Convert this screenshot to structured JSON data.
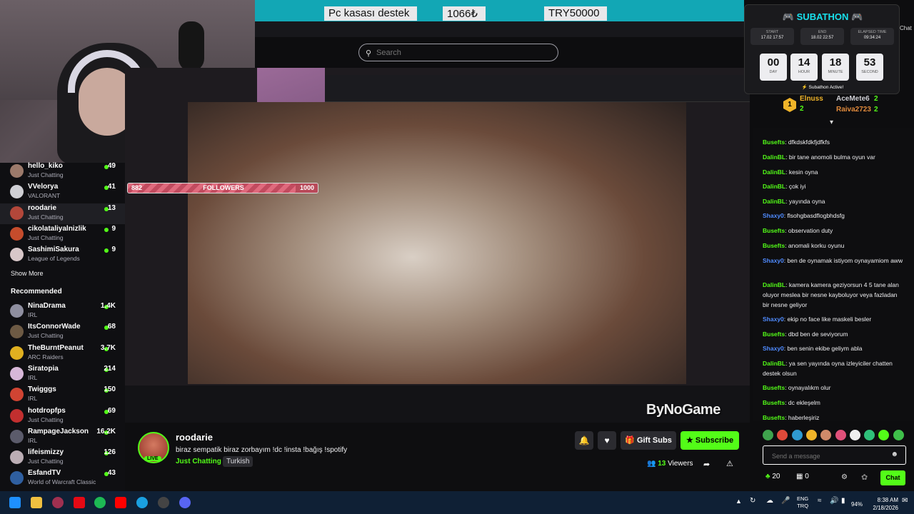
{
  "banner": {
    "ticker1": "Pc kasası destek",
    "ticker2": "1066₺",
    "ticker3": "TRY50000"
  },
  "search": {
    "placeholder": "Search"
  },
  "sidebar": {
    "following": [
      {
        "name": "hello_kiko",
        "category": "Just Chatting",
        "viewers": "49",
        "color": "#9c7a6b"
      },
      {
        "name": "VVelorya",
        "category": "VALORANT",
        "viewers": "41",
        "color": "#cfcfd4"
      },
      {
        "name": "roodarie",
        "category": "Just Chatting",
        "viewers": "13",
        "color": "#b3473a"
      },
      {
        "name": "cikolataliyalnizlik",
        "category": "Just Chatting",
        "viewers": "9",
        "color": "#c54c2c"
      },
      {
        "name": "SashimiSakura",
        "category": "League of Legends",
        "viewers": "9",
        "color": "#d8c7c9"
      }
    ],
    "show_more": "Show More",
    "recommended_title": "Recommended",
    "recommended": [
      {
        "name": "NinaDrama",
        "category": "IRL",
        "viewers": "1.4K",
        "color": "#8f8fa0"
      },
      {
        "name": "ItsConnorWade",
        "category": "Just Chatting",
        "viewers": "68",
        "color": "#6d5a44"
      },
      {
        "name": "TheBurntPeanut",
        "category": "ARC Raiders",
        "viewers": "3.7K",
        "color": "#e0b020"
      },
      {
        "name": "Siratopia",
        "category": "IRL",
        "viewers": "214",
        "color": "#d7b7d8"
      },
      {
        "name": "Twigggs",
        "category": "IRL",
        "viewers": "150",
        "color": "#d04433"
      },
      {
        "name": "hotdropfps",
        "category": "Just Chatting",
        "viewers": "69",
        "color": "#c22f2f"
      },
      {
        "name": "RampageJackson",
        "category": "IRL",
        "viewers": "16.2K",
        "color": "#5b5b6b"
      },
      {
        "name": "lifeismizzy",
        "category": "Just Chatting",
        "viewers": "126",
        "color": "#bcaeb5"
      },
      {
        "name": "EsfandTV",
        "category": "World of Warcraft Classic",
        "viewers": "43",
        "color": "#2f5fa0"
      }
    ]
  },
  "followers_goal": {
    "label": "FOLLOWERS",
    "current": "882",
    "target": "1000",
    "progress": 0.882
  },
  "watermark": "ByNoGame",
  "stream": {
    "streamer": "roodarie",
    "live": "LIVE",
    "title": "biraz sempatik biraz zorbayım !dc !insta !bağış !spotify",
    "category": "Just Chatting",
    "tag": "Turkish",
    "gift_label": "Gift Subs",
    "subscribe_label": "Subscribe",
    "viewers_count": "13",
    "viewers_label": "Viewers"
  },
  "subathon": {
    "title": "SUBATHON",
    "start_label": "START",
    "start_value": "17.02 17:57",
    "end_label": "END",
    "end_value": "18.02 22:57",
    "elapsed_label": "ELAPSED TIME",
    "elapsed_value": "09:34:24",
    "day": "00",
    "day_label": "DAY",
    "hour": "14",
    "hour_label": "HOUR",
    "minute": "18",
    "minute_label": "MINUTE",
    "second": "53",
    "second_label": "SECOND",
    "status": "Subathon Active!"
  },
  "chat_header": "Chat",
  "top_gifters": [
    {
      "name": "Elnuss",
      "count": "2"
    },
    {
      "name": "AceMete6",
      "count": "2"
    },
    {
      "name": "Raiva2723",
      "count": "2"
    }
  ],
  "chat": [
    {
      "user": "Busefts",
      "text": "dfkdskfdkfjdfkfs",
      "color": "#53fc18"
    },
    {
      "user": "DalinBL",
      "text": "bir tane anomoli bulma oyun var",
      "color": "#53fc18"
    },
    {
      "user": "DalinBL",
      "text": "kesin oyna",
      "color": "#53fc18"
    },
    {
      "user": "DalinBL",
      "text": "çok iyi",
      "color": "#53fc18"
    },
    {
      "user": "DalinBL",
      "text": "yayında oyna",
      "color": "#53fc18"
    },
    {
      "user": "Shaxy0",
      "text": "flsohgbasdflogbhdsfg",
      "color": "#4f8bff"
    },
    {
      "user": "Busefts",
      "text": "observation duty",
      "color": "#53fc18"
    },
    {
      "user": "Busefts",
      "text": "anomali korku oyunu",
      "color": "#53fc18"
    },
    {
      "user": "Shaxy0",
      "text": "ben de oynamak istiyom oynayamiom aww",
      "color": "#4f8bff"
    },
    {
      "user": "DalinBL",
      "text": "kamera kamera geziyorsun 4 5 tane alan oluyor meslea bir nesne kayboluyor veya fazladan bir nesne geliyor",
      "color": "#53fc18"
    },
    {
      "user": "Shaxy0",
      "text": "ekip no face like maskeli besler",
      "color": "#4f8bff"
    },
    {
      "user": "Busefts",
      "text": "dbd ben de seviyorum",
      "color": "#53fc18"
    },
    {
      "user": "Shaxy0",
      "text": "ben senin ekibe geliym abla",
      "color": "#4f8bff"
    },
    {
      "user": "DalinBL",
      "text": "ya sen yayında oyna izleyiciler chatten destek olsun",
      "color": "#53fc18"
    },
    {
      "user": "Busefts",
      "text": "oynayalıkm olur",
      "color": "#53fc18"
    },
    {
      "user": "Busefts",
      "text": "dc ekleşelm",
      "color": "#53fc18"
    },
    {
      "user": "Busefts",
      "text": "haberleşiriz",
      "color": "#53fc18"
    }
  ],
  "chat_input": {
    "placeholder": "Send a message"
  },
  "chat_footer": {
    "points": "20",
    "second_count": "0",
    "chat_button": "Chat"
  },
  "taskbar": {
    "lang_top": "ENG",
    "lang_bottom": "TRQ",
    "battery": "94%",
    "time": "8:38 AM",
    "date": "2/18/2026"
  },
  "colors": {
    "accent": "#53fc18",
    "banner": "#12a7b5",
    "subathon_title": "#18e0ec"
  }
}
